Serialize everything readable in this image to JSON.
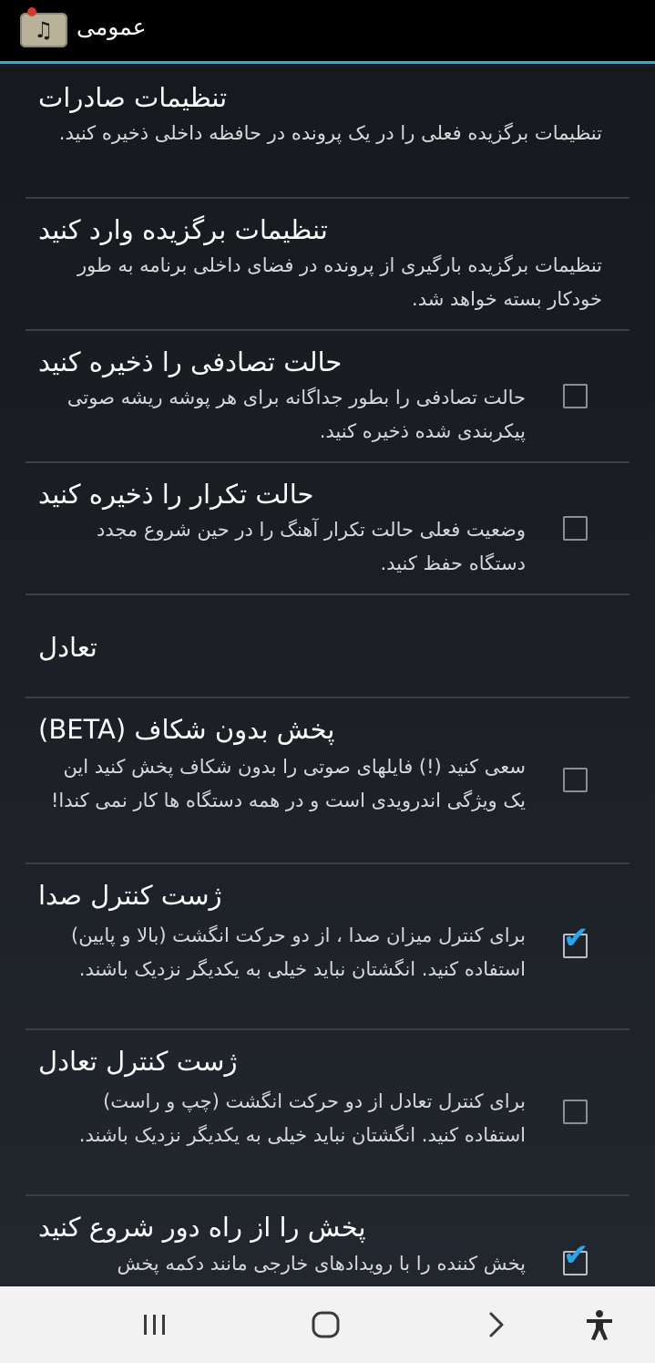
{
  "header": {
    "title": "عمومی",
    "icon": "music-note-icon"
  },
  "settings": [
    {
      "title": "تنظیمات صادرات",
      "summary": "تنظیمات برگزیده فعلی را در یک پرونده در حافظه داخلی ذخیره کنید.",
      "has_checkbox": false
    },
    {
      "title": "تنظیمات برگزیده وارد کنید",
      "summary": "تنظیمات برگزیده بارگیری از پرونده در فضای داخلی برنامه به طور خودکار بسته خواهد شد.",
      "has_checkbox": false
    },
    {
      "title": "حالت تصادفی را ذخیره کنید",
      "summary": "حالت تصادفی را بطور جداگانه برای هر پوشه ریشه صوتی پیکربندی شده ذخیره کنید.",
      "has_checkbox": true,
      "checked": false
    },
    {
      "title": "حالت تکرار را ذخیره کنید",
      "summary": "وضعیت فعلی حالت تکرار آهنگ را در حین شروع مجدد دستگاه حفظ کنید.",
      "has_checkbox": true,
      "checked": false
    }
  ],
  "category": {
    "title": "تعادل"
  },
  "settings2": [
    {
      "title": "پخش بدون شکاف (BETA)",
      "summary": "سعی کنید (!) فایلهای صوتی را بدون شکاف پخش کنید این یک ویژگی اندرویدی است و در همه دستگاه ها کار نمی کندا!",
      "has_checkbox": true,
      "checked": false
    },
    {
      "title": "ژست کنترل صدا",
      "summary": "برای کنترل میزان صدا ، از دو حرکت انگشت (بالا و پایین) استفاده کنید. انگشتان نباید خیلی به یکدیگر نزدیک باشند.",
      "has_checkbox": true,
      "checked": true
    },
    {
      "title": "ژست کنترل تعادل",
      "summary": "برای کنترل تعادل از دو حرکت انگشت (چپ و راست) استفاده کنید. انگشتان نباید خیلی به یکدیگر نزدیک باشند.",
      "has_checkbox": true,
      "checked": false
    },
    {
      "title": "پخش را از راه دور شروع کنید",
      "summary": "پخش کننده را با رویدادهای خارجی مانند دکمه پخش",
      "has_checkbox": true,
      "checked": true
    }
  ],
  "navbar": {
    "recent": "recent-apps-icon",
    "home": "home-icon",
    "back": "back-icon",
    "accessibility": "accessibility-icon"
  },
  "colors": {
    "accent": "#3fa3d9",
    "check": "#2aa4ea",
    "background": "#1b1f24"
  }
}
